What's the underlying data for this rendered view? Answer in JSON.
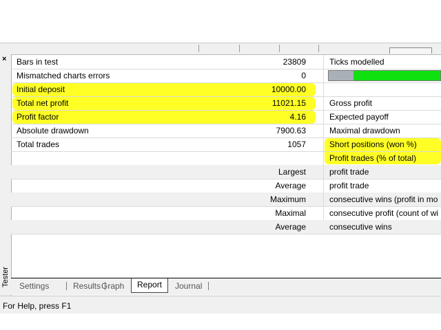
{
  "sidebar": {
    "close_glyph": "×",
    "title": "Tester",
    "close_icon": "close-icon"
  },
  "report": {
    "rows": [
      {
        "label": "Bars in test",
        "value": "23809",
        "right": "Ticks modelled"
      },
      {
        "label": "Mismatched charts errors",
        "value": "0",
        "right": ""
      },
      {
        "label": "Initial deposit",
        "value": "10000.00",
        "right": ""
      },
      {
        "label": "Total net profit",
        "value": "11021.15",
        "right": "Gross profit"
      },
      {
        "label": "Profit factor",
        "value": "4.16",
        "right": "Expected payoff"
      },
      {
        "label": "Absolute drawdown",
        "value": "7900.63",
        "right": "Maximal drawdown"
      },
      {
        "label": "Total trades",
        "value": "1057",
        "right": "Short positions (won %)"
      },
      {
        "label": "",
        "value": "",
        "right": "Profit trades (% of total)"
      },
      {
        "label": "",
        "value": "Largest",
        "right": "profit trade"
      },
      {
        "label": "",
        "value": "Average",
        "right": "profit trade"
      },
      {
        "label": "",
        "value": "Maximum",
        "right": "consecutive wins (profit in mo"
      },
      {
        "label": "",
        "value": "Maximal",
        "right": "consecutive profit (count of wi"
      },
      {
        "label": "",
        "value": "Average",
        "right": "consecutive wins"
      }
    ],
    "modelling_quality": {
      "fill_start_fraction": 0.22,
      "fill_end_fraction": 1.0
    }
  },
  "tabs": [
    "Settings",
    "Results",
    "Graph",
    "Report",
    "Journal"
  ],
  "active_tab": "Report",
  "status": {
    "text": "For Help, press F1"
  },
  "colors": {
    "highlight": "#ffff00",
    "progress_fill": "#10e010",
    "progress_bg": "#a9b0b8"
  }
}
